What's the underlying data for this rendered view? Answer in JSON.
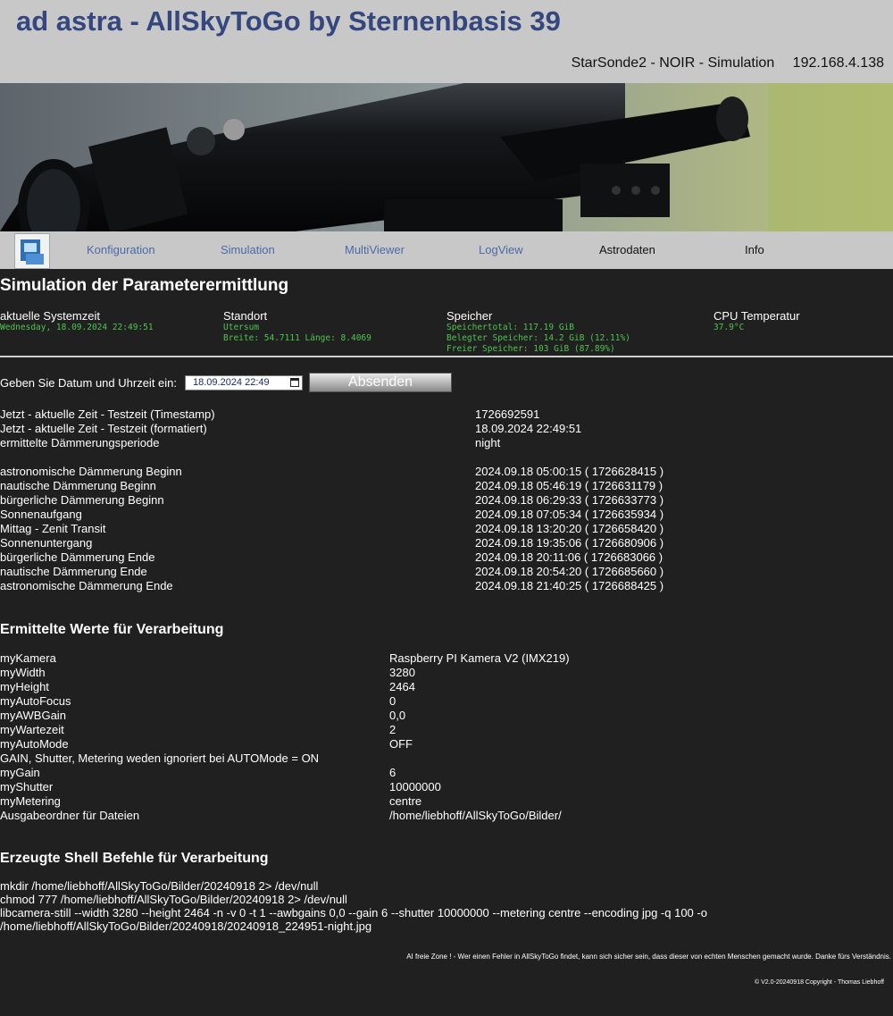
{
  "header": {
    "title": "ad astra - AllSkyToGo by Sternenbasis 39",
    "device": "StarSonde2 - NOIR - Simulation",
    "ip": "192.168.4.138"
  },
  "nav": {
    "items": [
      {
        "label": "Konfiguration"
      },
      {
        "label": "Simulation"
      },
      {
        "label": "MultiViewer"
      },
      {
        "label": "LogView"
      },
      {
        "label": "Astrodaten"
      },
      {
        "label": "Info"
      }
    ]
  },
  "page_title": "Simulation der Parameterermittlung",
  "stats": {
    "systemzeit": {
      "heading": "aktuelle Systemzeit",
      "value": "Wednesday, 18.09.2024 22:49:51"
    },
    "standort": {
      "heading": "Standort",
      "place": "Utersum",
      "coords": "Breite: 54.7111 Länge: 8.4069"
    },
    "speicher": {
      "heading": "Speicher",
      "total": "Speichertotal: 117.19 GiB",
      "used": "Belegter Speicher: 14.2 GiB (12.11%)",
      "free": "Freier Speicher: 103 GiB (87.89%)"
    },
    "cpu": {
      "heading": "CPU Temperatur",
      "value": "37.9°C"
    }
  },
  "form": {
    "label": "Geben Sie Datum und Uhrzeit ein:",
    "date_value": "18.09.2024 22:49",
    "submit_label": "Absenden"
  },
  "time_rows": [
    {
      "label": "Jetzt - aktuelle Zeit - Testzeit (Timestamp)",
      "value": "1726692591"
    },
    {
      "label": "Jetzt - aktuelle Zeit - Testzeit (formatiert)",
      "value": "18.09.2024 22:49:51"
    },
    {
      "label": "ermittelte Dämmerungsperiode",
      "value": "night"
    }
  ],
  "twilight_rows": [
    {
      "label": "astronomische Dämmerung Beginn",
      "value": "2024.09.18 05:00:15 ( 1726628415 )"
    },
    {
      "label": "nautische Dämmerung Beginn",
      "value": "2024.09.18 05:46:19 ( 1726631179 )"
    },
    {
      "label": "bürgerliche Dämmerung Beginn",
      "value": "2024.09.18 06:29:33 ( 1726633773 )"
    },
    {
      "label": "Sonnenaufgang",
      "value": "2024.09.18 07:05:34 ( 1726635934 )"
    },
    {
      "label": "Mittag - Zenit Transit",
      "value": "2024.09.18 13:20:20 ( 1726658420 )"
    },
    {
      "label": "Sonnenuntergang",
      "value": "2024.09.18 19:35:06 ( 1726680906 )"
    },
    {
      "label": "bürgerliche Dämmerung Ende",
      "value": "2024.09.18 20:11:06 ( 1726683066 )"
    },
    {
      "label": "nautische Dämmerung Ende",
      "value": "2024.09.18 20:54:20 ( 1726685660 )"
    },
    {
      "label": "astronomische Dämmerung Ende",
      "value": "2024.09.18 21:40:25 ( 1726688425 )"
    }
  ],
  "values_heading": "Ermittelte Werte für Verarbeitung",
  "value_rows": [
    {
      "label": "myKamera",
      "value": "Raspberry PI Kamera V2 (IMX219)"
    },
    {
      "label": "myWidth",
      "value": "3280"
    },
    {
      "label": "myHeight",
      "value": "2464"
    },
    {
      "label": "myAutoFocus",
      "value": "0"
    },
    {
      "label": "myAWBGain",
      "value": "0,0"
    },
    {
      "label": "myWartezeit",
      "value": "2"
    },
    {
      "label": "myAutoMode",
      "value": "OFF"
    },
    {
      "label": "GAIN, Shutter, Metering weden ignoriert bei AUTOMode = ON",
      "value": ""
    },
    {
      "label": "myGain",
      "value": "6"
    },
    {
      "label": "myShutter",
      "value": "10000000"
    },
    {
      "label": "myMetering",
      "value": "centre"
    },
    {
      "label": "Ausgabeordner für Dateien",
      "value": "/home/liebhoff/AllSkyToGo/Bilder/"
    }
  ],
  "shell_heading": "Erzeugte Shell Befehle für Verarbeitung",
  "shell_lines": [
    "mkdir /home/liebhoff/AllSkyToGo/Bilder/20240918 2> /dev/null",
    "chmod 777 /home/liebhoff/AllSkyToGo/Bilder/20240918 2> /dev/null",
    "libcamera-still --width 3280 --height 2464 -n -v 0 -t 1 --awbgains 0,0 --gain 6 --shutter 10000000 --metering centre --encoding jpg -q 100 -o",
    "/home/liebhoff/AllSkyToGo/Bilder/20240918/20240918_224951-night.jpg"
  ],
  "footer": {
    "note": "AI freie Zone ! - Wer einen Fehler in AllSkyToGo findet, kann sich sicher sein, dass dieser von echten Menschen gemacht wurde. Danke fürs Verständnis.",
    "copyright": "© V2.0-20240918 Copyright - Thomas Liebhoff"
  }
}
